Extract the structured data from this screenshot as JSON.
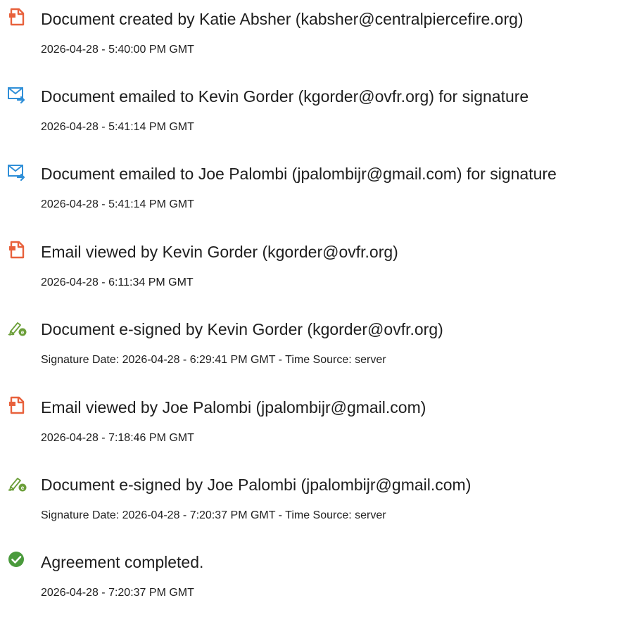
{
  "colors": {
    "document_icon": "#e8613c",
    "email_icon": "#2f8fd8",
    "signed_icon": "#6c9f3a",
    "completed_icon": "#4a9a3c",
    "text": "#1e1e1e"
  },
  "events": [
    {
      "icon": "document-icon",
      "title": "Document created by Katie Absher (kabsher@centralpiercefire.org)",
      "timestamp": "2026-04-28 - 5:40:00 PM GMT"
    },
    {
      "icon": "email-icon",
      "title": "Document emailed to Kevin Gorder (kgorder@ovfr.org) for signature",
      "timestamp": "2026-04-28 - 5:41:14 PM GMT"
    },
    {
      "icon": "email-icon",
      "title": "Document emailed to Joe Palombi (jpalombijr@gmail.com) for signature",
      "timestamp": "2026-04-28 - 5:41:14 PM GMT"
    },
    {
      "icon": "document-icon",
      "title": "Email viewed by Kevin Gorder (kgorder@ovfr.org)",
      "timestamp": "2026-04-28 - 6:11:34 PM GMT"
    },
    {
      "icon": "esign-icon",
      "title": "Document e-signed by Kevin Gorder (kgorder@ovfr.org)",
      "timestamp": "Signature Date: 2026-04-28 - 6:29:41 PM GMT - Time Source: server"
    },
    {
      "icon": "document-icon",
      "title": "Email viewed by Joe Palombi (jpalombijr@gmail.com)",
      "timestamp": "2026-04-28 - 7:18:46 PM GMT"
    },
    {
      "icon": "esign-icon",
      "title": "Document e-signed by Joe Palombi (jpalombijr@gmail.com)",
      "timestamp": "Signature Date: 2026-04-28 - 7:20:37 PM GMT - Time Source: server"
    },
    {
      "icon": "check-circle-icon",
      "title": "Agreement completed.",
      "timestamp": "2026-04-28 - 7:20:37 PM GMT"
    }
  ]
}
